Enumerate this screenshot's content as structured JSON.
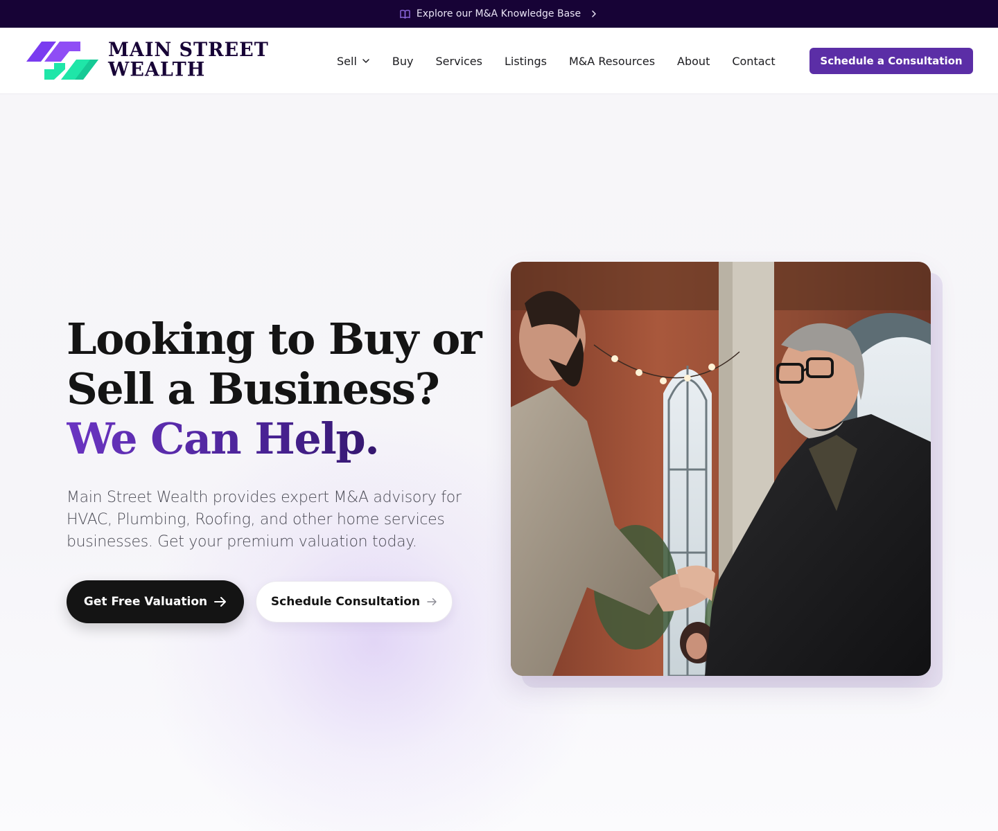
{
  "announcement": {
    "text": "Explore our M&A Knowledge Base",
    "icon": "book-icon"
  },
  "brand": {
    "line1": "MAIN STREET",
    "line2": "WEALTH",
    "colors": {
      "purple": "#7a3cf0",
      "green": "#1fe6a8",
      "navy": "#170336"
    }
  },
  "nav": {
    "items": [
      {
        "label": "Sell",
        "has_dropdown": true
      },
      {
        "label": "Buy"
      },
      {
        "label": "Services"
      },
      {
        "label": "Listings"
      },
      {
        "label": "M&A Resources"
      },
      {
        "label": "About"
      },
      {
        "label": "Contact"
      }
    ],
    "cta": "Schedule a Consultation"
  },
  "hero": {
    "headline_line1": "Looking to Buy or",
    "headline_line2": "Sell a Business?",
    "headline_accent": "We Can Help.",
    "subtext": "Main Street Wealth provides expert M&A advisory for HVAC, Plumbing, Roofing, and other home services businesses. Get your premium valuation today.",
    "primary_button": "Get Free Valuation",
    "secondary_button": "Schedule Consultation",
    "image_alt": "two-businessmen-shaking-hands"
  },
  "colors": {
    "accent": "#5b2ea6",
    "announcement_bg": "#170336",
    "primary_button_bg": "#141414"
  }
}
